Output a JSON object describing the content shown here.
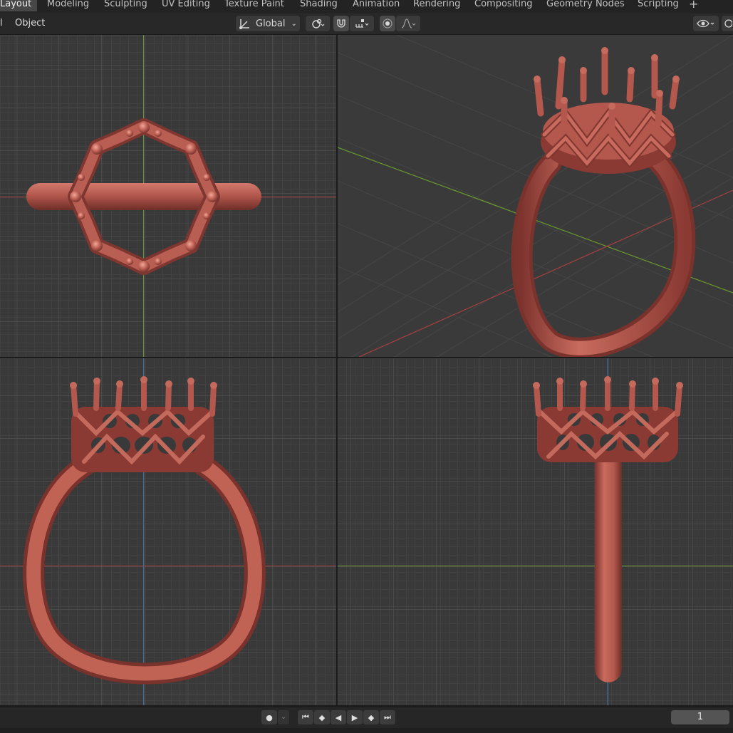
{
  "workspace_tabs": [
    {
      "label": "Layout",
      "active": true
    },
    {
      "label": "Modeling"
    },
    {
      "label": "Sculpting"
    },
    {
      "label": "UV Editing"
    },
    {
      "label": "Texture Paint"
    },
    {
      "label": "Shading"
    },
    {
      "label": "Animation"
    },
    {
      "label": "Rendering"
    },
    {
      "label": "Compositing"
    },
    {
      "label": "Geometry Nodes"
    },
    {
      "label": "Scripting"
    }
  ],
  "add_tab_label": "+",
  "toolbar": {
    "left_cut_label": "l",
    "object_menu": "Object",
    "transform_orientation": "Global"
  },
  "icons": {
    "transform": "transform-orientation-icon",
    "pivot": "pivot-point-icon",
    "snap": "snap-magnet-icon",
    "snap_target": "snap-increment-icon",
    "proportional": "proportional-edit-icon",
    "falloff": "falloff-curve-icon",
    "visibility": "eye-visibility-icon"
  },
  "colors": {
    "ring_material": "#b4584d",
    "axis_x": "#a3413f",
    "axis_y": "#6a9a2c",
    "axis_z": "#3d6fa8",
    "viewport_bg": "#393939"
  },
  "viewports": [
    {
      "name": "top-view"
    },
    {
      "name": "perspective-view"
    },
    {
      "name": "front-view"
    },
    {
      "name": "side-view"
    }
  ],
  "timeline": {
    "current_frame": "1"
  }
}
